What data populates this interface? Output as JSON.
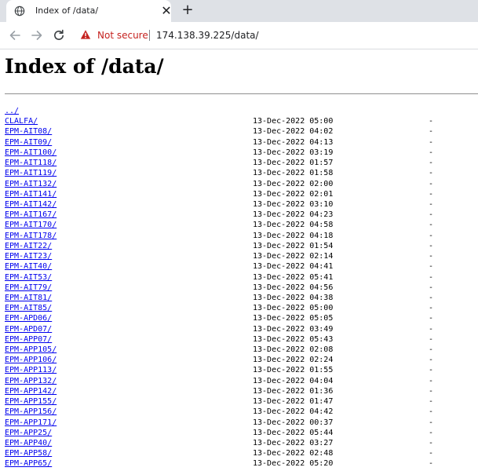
{
  "browser": {
    "tab_title": "Index of /data/",
    "security_label": "Not secure",
    "url": "174.138.39.225/data/"
  },
  "page": {
    "heading": "Index of /data/",
    "parent_link": "../",
    "entries": [
      {
        "name": "CLALFA/",
        "date": "13-Dec-2022 05:00",
        "size": "-"
      },
      {
        "name": "EPM-AIT08/",
        "date": "13-Dec-2022 04:02",
        "size": "-"
      },
      {
        "name": "EPM-AIT09/",
        "date": "13-Dec-2022 04:13",
        "size": "-"
      },
      {
        "name": "EPM-AIT100/",
        "date": "13-Dec-2022 03:19",
        "size": "-"
      },
      {
        "name": "EPM-AIT118/",
        "date": "13-Dec-2022 01:57",
        "size": "-"
      },
      {
        "name": "EPM-AIT119/",
        "date": "13-Dec-2022 01:58",
        "size": "-"
      },
      {
        "name": "EPM-AIT132/",
        "date": "13-Dec-2022 02:00",
        "size": "-"
      },
      {
        "name": "EPM-AIT141/",
        "date": "13-Dec-2022 02:01",
        "size": "-"
      },
      {
        "name": "EPM-AIT142/",
        "date": "13-Dec-2022 03:10",
        "size": "-"
      },
      {
        "name": "EPM-AIT167/",
        "date": "13-Dec-2022 04:23",
        "size": "-"
      },
      {
        "name": "EPM-AIT170/",
        "date": "13-Dec-2022 04:58",
        "size": "-"
      },
      {
        "name": "EPM-AIT178/",
        "date": "13-Dec-2022 04:18",
        "size": "-"
      },
      {
        "name": "EPM-AIT22/",
        "date": "13-Dec-2022 01:54",
        "size": "-"
      },
      {
        "name": "EPM-AIT23/",
        "date": "13-Dec-2022 02:14",
        "size": "-"
      },
      {
        "name": "EPM-AIT40/",
        "date": "13-Dec-2022 04:41",
        "size": "-"
      },
      {
        "name": "EPM-AIT53/",
        "date": "13-Dec-2022 05:41",
        "size": "-"
      },
      {
        "name": "EPM-AIT79/",
        "date": "13-Dec-2022 04:56",
        "size": "-"
      },
      {
        "name": "EPM-AIT81/",
        "date": "13-Dec-2022 04:38",
        "size": "-"
      },
      {
        "name": "EPM-AIT85/",
        "date": "13-Dec-2022 05:00",
        "size": "-"
      },
      {
        "name": "EPM-APD06/",
        "date": "13-Dec-2022 05:05",
        "size": "-"
      },
      {
        "name": "EPM-APD07/",
        "date": "13-Dec-2022 03:49",
        "size": "-"
      },
      {
        "name": "EPM-APP07/",
        "date": "13-Dec-2022 05:43",
        "size": "-"
      },
      {
        "name": "EPM-APP105/",
        "date": "13-Dec-2022 02:08",
        "size": "-"
      },
      {
        "name": "EPM-APP106/",
        "date": "13-Dec-2022 02:24",
        "size": "-"
      },
      {
        "name": "EPM-APP113/",
        "date": "13-Dec-2022 01:55",
        "size": "-"
      },
      {
        "name": "EPM-APP132/",
        "date": "13-Dec-2022 04:04",
        "size": "-"
      },
      {
        "name": "EPM-APP142/",
        "date": "13-Dec-2022 01:36",
        "size": "-"
      },
      {
        "name": "EPM-APP155/",
        "date": "13-Dec-2022 01:47",
        "size": "-"
      },
      {
        "name": "EPM-APP156/",
        "date": "13-Dec-2022 04:42",
        "size": "-"
      },
      {
        "name": "EPM-APP171/",
        "date": "13-Dec-2022 00:37",
        "size": "-"
      },
      {
        "name": "EPM-APP25/",
        "date": "13-Dec-2022 05:44",
        "size": "-"
      },
      {
        "name": "EPM-APP40/",
        "date": "13-Dec-2022 03:27",
        "size": "-"
      },
      {
        "name": "EPM-APP58/",
        "date": "13-Dec-2022 02:48",
        "size": "-"
      },
      {
        "name": "EPM-APP65/",
        "date": "13-Dec-2022 05:20",
        "size": "-"
      }
    ]
  },
  "colors": {
    "tabbar_bg": "#dee1e6",
    "link": "#0000ee",
    "not_secure": "#c5221f"
  },
  "icons": [
    "globe-icon",
    "close-icon",
    "plus-icon",
    "arrow-left-icon",
    "arrow-right-icon",
    "reload-icon",
    "warning-icon"
  ]
}
